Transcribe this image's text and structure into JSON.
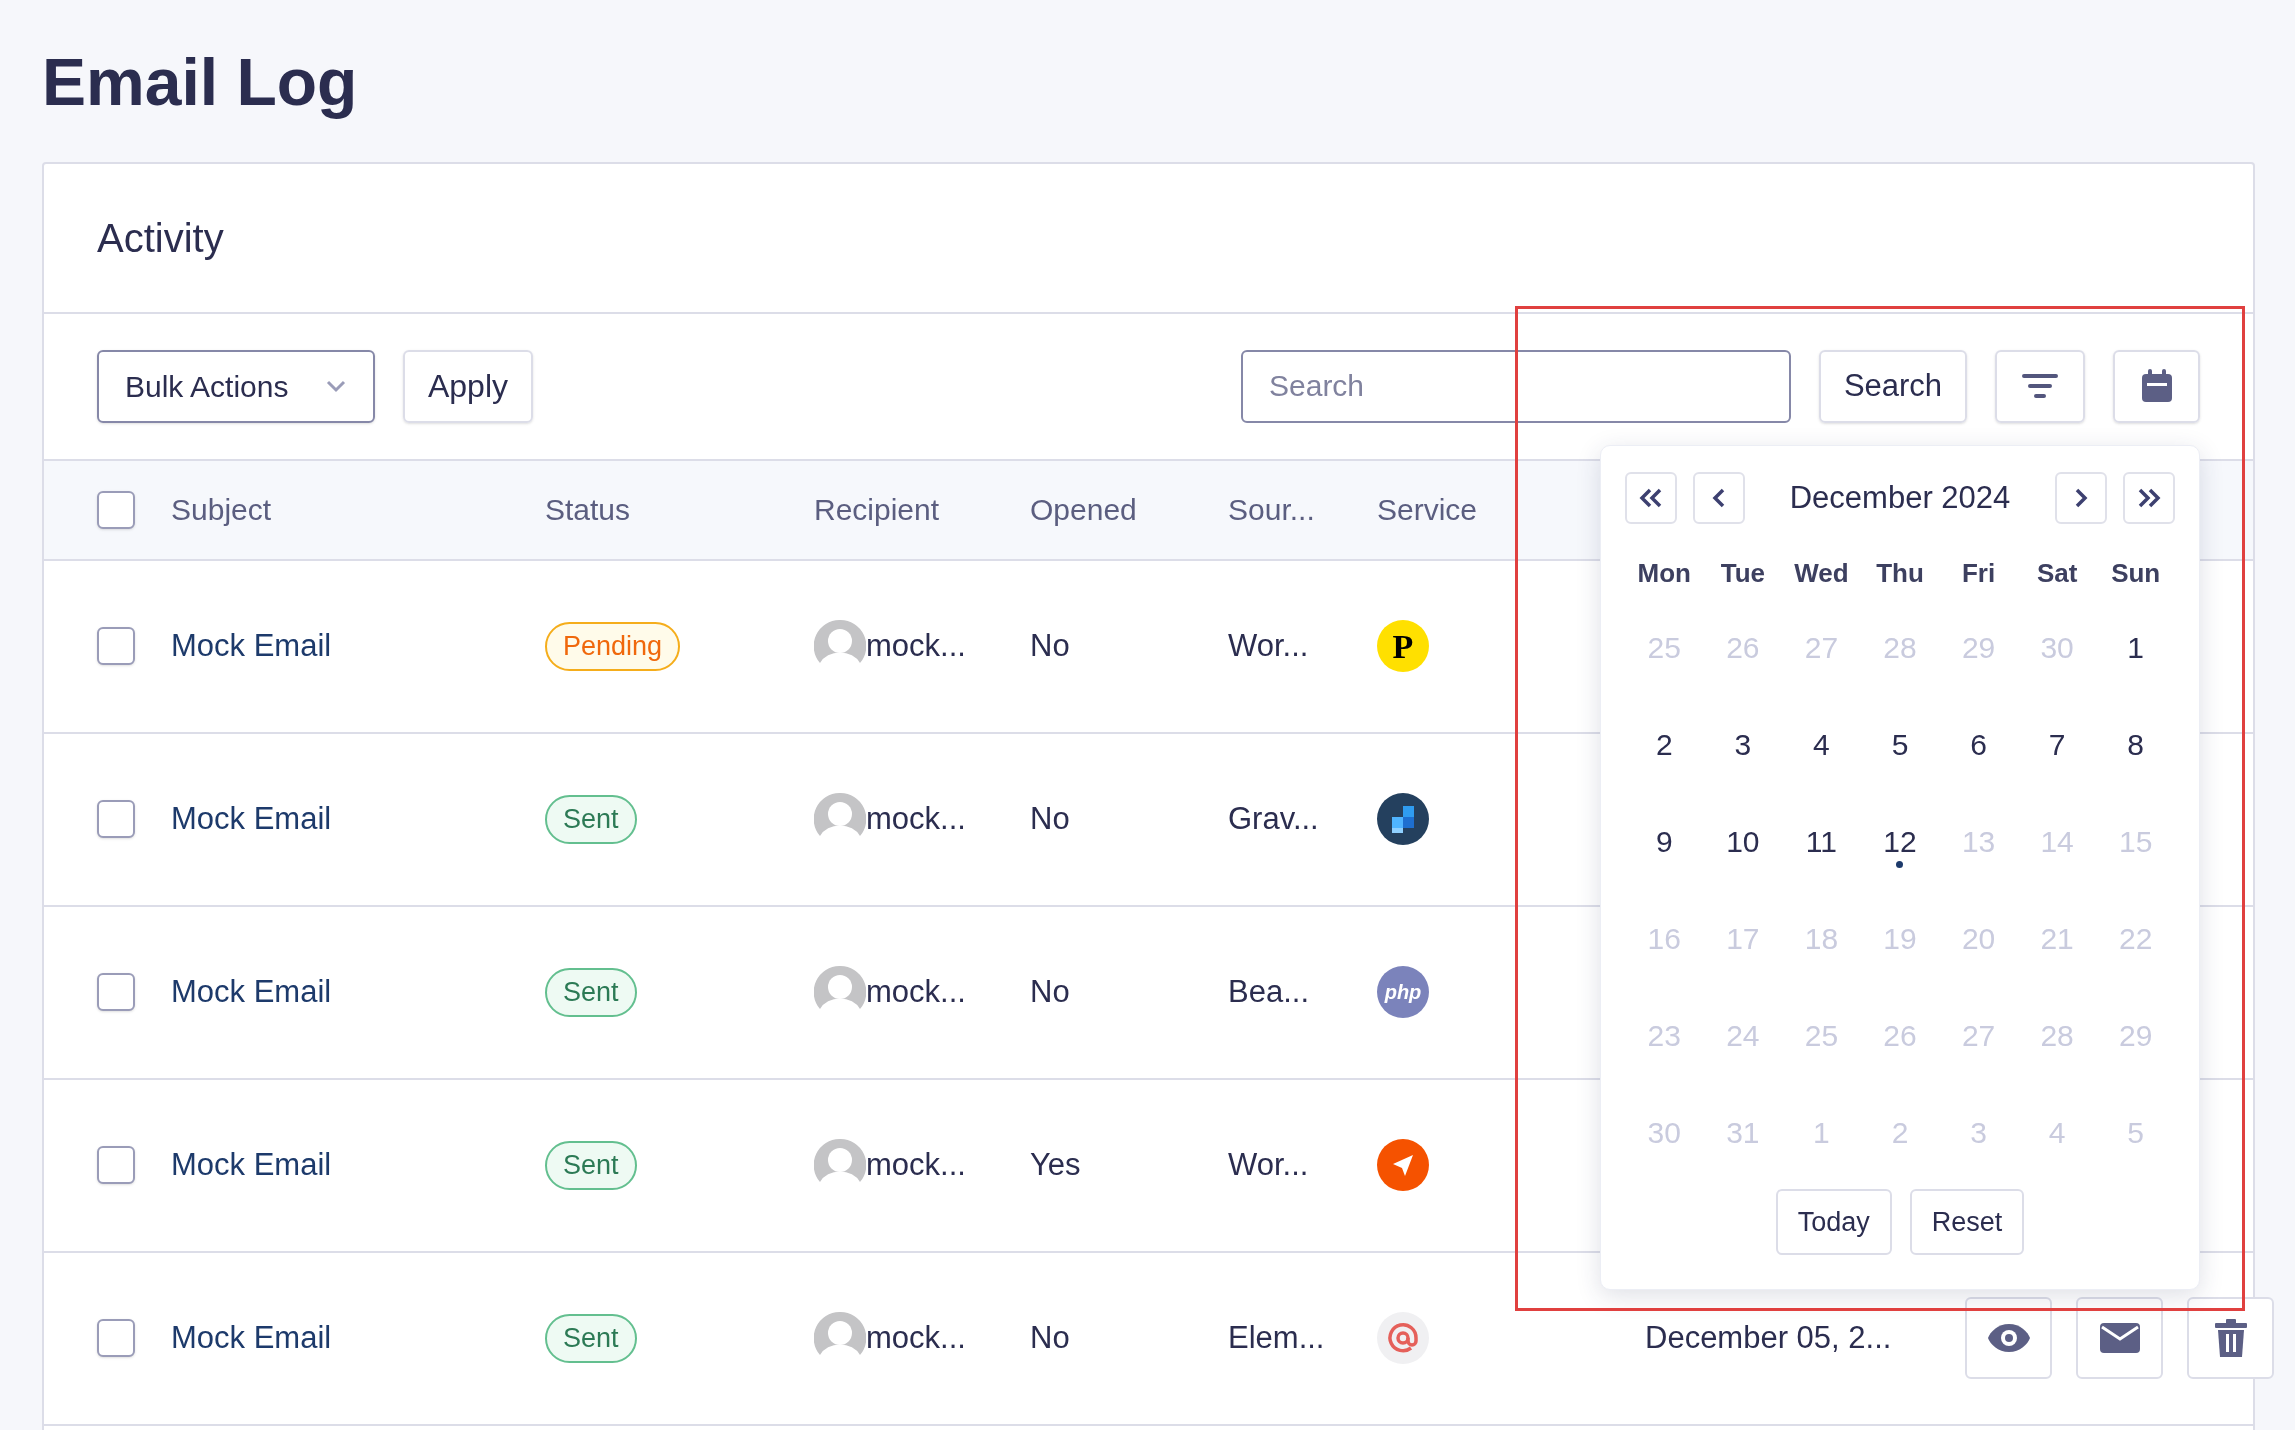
{
  "page": {
    "title": "Email Log"
  },
  "card": {
    "title": "Activity"
  },
  "toolbar": {
    "bulk_actions": "Bulk Actions",
    "apply": "Apply",
    "search": {
      "placeholder": "Search"
    },
    "search_button": "Search"
  },
  "table": {
    "select_all": {
      "checked": false
    },
    "columns": [
      "Subject",
      "Status",
      "Recipient",
      "Opened",
      "Sour...",
      "Service"
    ],
    "rows": [
      {
        "checked": false,
        "subject": "Mock Email",
        "status": {
          "label": "Pending",
          "kind": "pending"
        },
        "recipient": "mock...",
        "opened": "No",
        "source": "Wor...",
        "service": {
          "kind": "letter",
          "text": "P"
        }
      },
      {
        "checked": false,
        "subject": "Mock Email",
        "status": {
          "label": "Sent",
          "kind": "sent"
        },
        "recipient": "mock...",
        "opened": "No",
        "source": "Grav...",
        "service": {
          "kind": "pixels"
        }
      },
      {
        "checked": false,
        "subject": "Mock Email",
        "status": {
          "label": "Sent",
          "kind": "sent"
        },
        "recipient": "mock...",
        "opened": "No",
        "source": "Bea...",
        "service": {
          "kind": "word",
          "text": "php"
        }
      },
      {
        "checked": false,
        "subject": "Mock Email",
        "status": {
          "label": "Sent",
          "kind": "sent"
        },
        "recipient": "mock...",
        "opened": "Yes",
        "source": "Wor...",
        "service": {
          "kind": "plane"
        }
      },
      {
        "checked": false,
        "subject": "Mock Email",
        "status": {
          "label": "Sent",
          "kind": "sent"
        },
        "recipient": "mock...",
        "opened": "No",
        "source": "Elem...",
        "service": {
          "kind": "at"
        },
        "date": "December 05, 2..."
      }
    ]
  },
  "calendar": {
    "month": "December 2024",
    "weekdays": [
      "Mon",
      "Tue",
      "Wed",
      "Thu",
      "Fri",
      "Sat",
      "Sun"
    ],
    "days": [
      {
        "label": "25",
        "disabled": true,
        "today": false
      },
      {
        "label": "26",
        "disabled": true,
        "today": false
      },
      {
        "label": "27",
        "disabled": true,
        "today": false
      },
      {
        "label": "28",
        "disabled": true,
        "today": false
      },
      {
        "label": "29",
        "disabled": true,
        "today": false
      },
      {
        "label": "30",
        "disabled": true,
        "today": false
      },
      {
        "label": "1",
        "disabled": false,
        "today": false
      },
      {
        "label": "2",
        "disabled": false,
        "today": false
      },
      {
        "label": "3",
        "disabled": false,
        "today": false
      },
      {
        "label": "4",
        "disabled": false,
        "today": false
      },
      {
        "label": "5",
        "disabled": false,
        "today": false
      },
      {
        "label": "6",
        "disabled": false,
        "today": false
      },
      {
        "label": "7",
        "disabled": false,
        "today": false
      },
      {
        "label": "8",
        "disabled": false,
        "today": false
      },
      {
        "label": "9",
        "disabled": false,
        "today": false
      },
      {
        "label": "10",
        "disabled": false,
        "today": false
      },
      {
        "label": "11",
        "disabled": false,
        "today": false
      },
      {
        "label": "12",
        "disabled": false,
        "today": true
      },
      {
        "label": "13",
        "disabled": true,
        "today": false
      },
      {
        "label": "14",
        "disabled": true,
        "today": false
      },
      {
        "label": "15",
        "disabled": true,
        "today": false
      },
      {
        "label": "16",
        "disabled": true,
        "today": false
      },
      {
        "label": "17",
        "disabled": true,
        "today": false
      },
      {
        "label": "18",
        "disabled": true,
        "today": false
      },
      {
        "label": "19",
        "disabled": true,
        "today": false
      },
      {
        "label": "20",
        "disabled": true,
        "today": false
      },
      {
        "label": "21",
        "disabled": true,
        "today": false
      },
      {
        "label": "22",
        "disabled": true,
        "today": false
      },
      {
        "label": "23",
        "disabled": true,
        "today": false
      },
      {
        "label": "24",
        "disabled": true,
        "today": false
      },
      {
        "label": "25",
        "disabled": true,
        "today": false
      },
      {
        "label": "26",
        "disabled": true,
        "today": false
      },
      {
        "label": "27",
        "disabled": true,
        "today": false
      },
      {
        "label": "28",
        "disabled": true,
        "today": false
      },
      {
        "label": "29",
        "disabled": true,
        "today": false
      },
      {
        "label": "30",
        "disabled": true,
        "today": false
      },
      {
        "label": "31",
        "disabled": true,
        "today": false
      },
      {
        "label": "1",
        "disabled": true,
        "today": false
      },
      {
        "label": "2",
        "disabled": true,
        "today": false
      },
      {
        "label": "3",
        "disabled": true,
        "today": false
      },
      {
        "label": "4",
        "disabled": true,
        "today": false
      },
      {
        "label": "5",
        "disabled": true,
        "today": false
      }
    ],
    "buttons": [
      "Today",
      "Reset"
    ]
  }
}
